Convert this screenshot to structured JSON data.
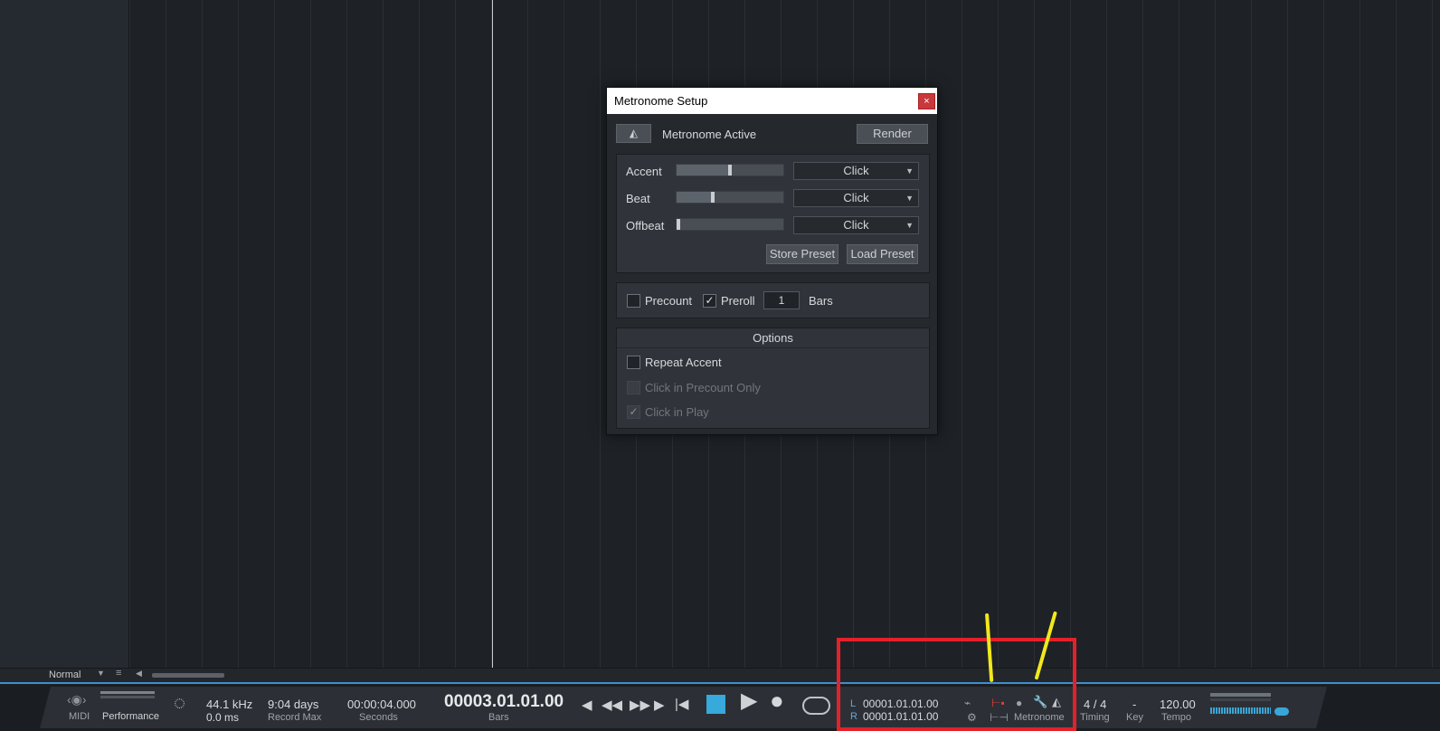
{
  "dialog": {
    "title": "Metronome Setup",
    "close": "×",
    "metronome_active": "Metronome Active",
    "render": "Render",
    "rows": [
      {
        "label": "Accent",
        "level": 0.5,
        "sound": "Click"
      },
      {
        "label": "Beat",
        "level": 0.34,
        "sound": "Click"
      },
      {
        "label": "Offbeat",
        "level": 0.02,
        "sound": "Click"
      }
    ],
    "store_preset": "Store Preset",
    "load_preset": "Load Preset",
    "precount": {
      "label": "Precount",
      "checked": false
    },
    "preroll": {
      "label": "Preroll",
      "checked": true,
      "check_glyph": "✓"
    },
    "bars_value": "1",
    "bars_label": "Bars",
    "options": {
      "title": "Options",
      "repeat_accent": {
        "label": "Repeat Accent",
        "checked": false
      },
      "click_precount_only": {
        "label": "Click in Precount Only",
        "checked": false
      },
      "click_in_play": {
        "label": "Click in Play",
        "checked": true,
        "check_glyph": "✓"
      }
    }
  },
  "statusbar": {
    "mode": "Normal",
    "menu_glyph": "≡"
  },
  "transport": {
    "midi_label": "MIDI",
    "performance_label": "Performance",
    "sample_rate": "44.1 kHz",
    "latency": "0.0 ms",
    "record_max_value": "9:04 days",
    "record_max_label": "Record Max",
    "seconds_value": "00:00:04.000",
    "seconds_label": "Seconds",
    "bars_value": "00003.01.01.00",
    "bars_label": "Bars",
    "loop_left_tag": "L",
    "loop_left": "00001.01.01.00",
    "loop_right_tag": "R",
    "loop_right": "00001.01.01.00",
    "metronome_label": "Metronome",
    "timing_value": "4 / 4",
    "timing_label": "Timing",
    "key_value": "-",
    "key_label": "Key",
    "tempo_value": "120.00",
    "tempo_label": "Tempo"
  },
  "colors": {
    "accent_blue": "#37a9db",
    "annotation_red": "#e3212b",
    "annotation_yellow": "#f2e81d"
  }
}
